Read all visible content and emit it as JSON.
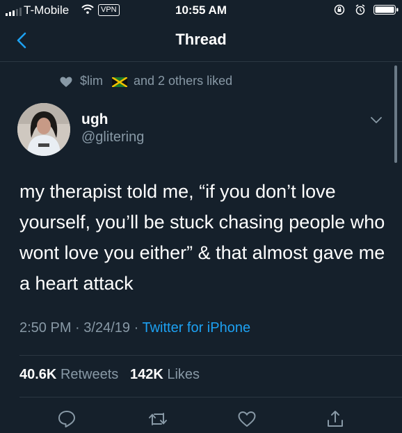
{
  "status_bar": {
    "carrier": "T-Mobile",
    "vpn": "VPN",
    "time": "10:55 AM"
  },
  "nav": {
    "title": "Thread"
  },
  "social_context": {
    "liker": "$lim",
    "rest": "and 2 others liked"
  },
  "tweet": {
    "author_name": "ugh",
    "author_handle": "@glitering",
    "text": "my therapist told me, “if you don’t love yourself, you’ll be stuck chasing people who wont love you either” & that almost gave me a heart attack",
    "time": "2:50 PM",
    "date": "3/24/19",
    "source": "Twitter for iPhone",
    "separator": "·"
  },
  "stats": {
    "retweets_count": "40.6K",
    "retweets_label": "Retweets",
    "likes_count": "142K",
    "likes_label": "Likes"
  },
  "colors": {
    "background": "#15202b",
    "secondary_text": "#8899a6",
    "link": "#1da1f2",
    "divider": "#2b3742"
  },
  "icons": [
    "signal-icon",
    "wifi-icon",
    "rotation-lock-icon",
    "alarm-icon",
    "battery-icon",
    "back-chevron-icon",
    "heart-icon",
    "jamaica-flag-icon",
    "chevron-down-icon",
    "reply-icon",
    "retweet-icon",
    "like-icon",
    "share-icon"
  ]
}
